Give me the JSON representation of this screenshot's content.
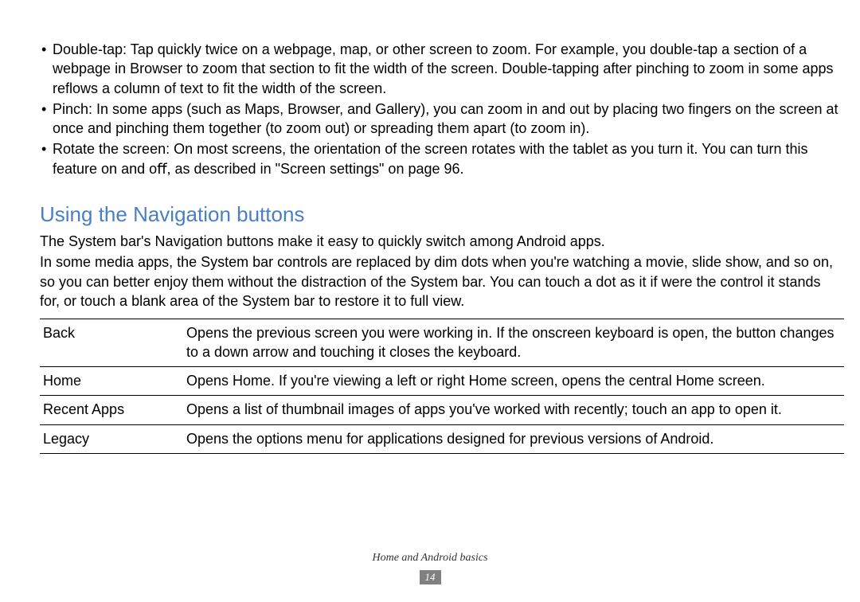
{
  "bullets": [
    "Double-tap: Tap quickly twice on a webpage, map, or other screen to zoom. For example, you double-tap a section of a webpage in Browser to zoom that section to ﬁt the width of the screen. Double-tapping after pinching to zoom in some apps reﬂows a column of text to ﬁt the width of the screen.",
    "Pinch: In some apps (such as Maps, Browser, and Gallery), you can zoom in and out by placing two ﬁngers on the screen at once and pinching them together (to zoom out) or spreading them apart (to zoom in).",
    "Rotate the screen: On most screens, the orientation of the screen rotates with the tablet as you turn it. You can turn this feature on and oﬀ, as described in \"Screen settings\" on page 96."
  ],
  "heading": "Using the Navigation buttons",
  "intro": [
    "The System bar's Navigation buttons make it easy to quickly switch among Android apps.",
    "In some media apps, the System bar controls are replaced by dim dots when you're watching a movie, slide show, and so on, so you can better enjoy them without the distraction of the System bar. You can touch a dot as it if were the control it stands for, or touch a blank area of the System bar to restore it to full view."
  ],
  "table_rows": [
    {
      "label": "Back",
      "desc": "Opens the previous screen you were working in. If the onscreen keyboard is open, the button changes to a down arrow and touching it closes the keyboard."
    },
    {
      "label": "Home",
      "desc": "Opens Home. If you're viewing a left or right Home screen, opens the central Home screen."
    },
    {
      "label": "Recent Apps",
      "desc": "Opens a list of thumbnail images of apps you've worked with recently; touch an app to open it."
    },
    {
      "label": "Legacy",
      "desc": "Opens the options menu for applications designed for previous versions of Android."
    }
  ],
  "footer": {
    "title": "Home and Android basics",
    "page": "14"
  }
}
